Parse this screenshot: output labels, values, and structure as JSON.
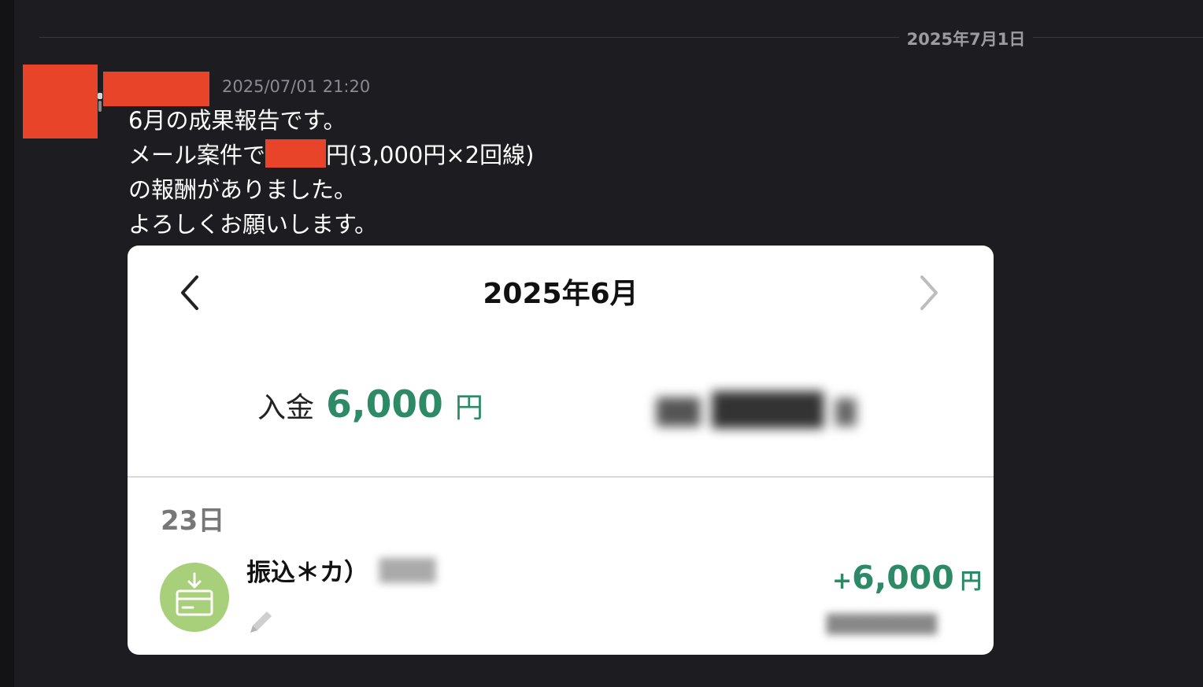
{
  "divider": {
    "date": "2025年7月1日"
  },
  "message": {
    "timestamp": "2025/07/01 21:20",
    "lines": {
      "l1": "6月の成果報告です。",
      "l2_before": "メール案件で",
      "l2_after": "円(3,000円×2回線)",
      "l3": "の報酬がありました。",
      "l4": "よろしくお願いします。"
    }
  },
  "card": {
    "month_title": "2025年6月",
    "prev_icon": "chevron-left-icon",
    "next_icon": "chevron-right-icon",
    "summary": {
      "income_label": "入金",
      "income_amount": "6,000",
      "income_unit": "円"
    },
    "transaction": {
      "day": "23日",
      "name": "振込＊カ）",
      "sign": "+",
      "amount": "6,000",
      "unit": "円",
      "icon": "deposit-card-icon",
      "edit_icon": "pencil-icon"
    },
    "colors": {
      "positive": "#2c8a66",
      "icon_bg": "#a8cf7a"
    }
  },
  "theme": {
    "background": "#1d1c21",
    "redaction": "#e8442a"
  }
}
